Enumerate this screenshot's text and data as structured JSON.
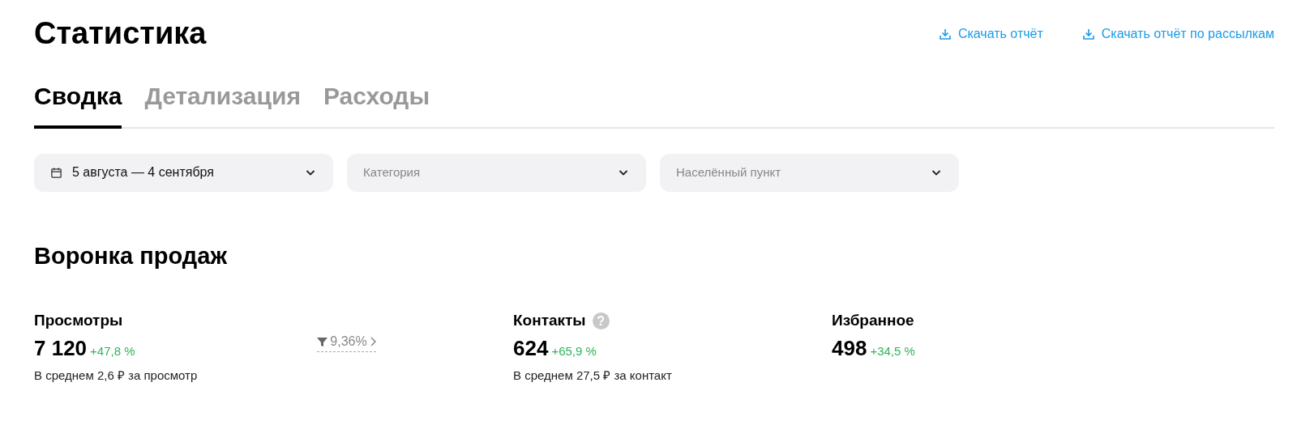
{
  "page": {
    "title": "Статистика"
  },
  "downloads": [
    "Скачать отчёт",
    "Скачать отчёт по рассылкам"
  ],
  "tabs": [
    {
      "label": "Сводка",
      "selected": true
    },
    {
      "label": "Детализация",
      "selected": false
    },
    {
      "label": "Расходы",
      "selected": false
    }
  ],
  "filters": [
    {
      "kind": "date",
      "value": "5 августа — 4 сентября"
    },
    {
      "kind": "select",
      "placeholder": "Категория"
    },
    {
      "kind": "select",
      "placeholder": "Населённый пункт"
    }
  ],
  "funnel": {
    "title": "Воронка продаж",
    "metrics": [
      {
        "label": "Просмотры",
        "help": false,
        "value": "7 120",
        "change": "+47,8 %",
        "average": "В среднем 2,6 ₽ за просмотр",
        "conversion": "9,36%"
      },
      {
        "label": "Контакты",
        "help": true,
        "value": "624",
        "change": "+65,9 %",
        "average": "В среднем 27,5 ₽ за контакт"
      },
      {
        "label": "Избранное",
        "help": false,
        "value": "498",
        "change": "+34,5 %"
      }
    ]
  }
}
